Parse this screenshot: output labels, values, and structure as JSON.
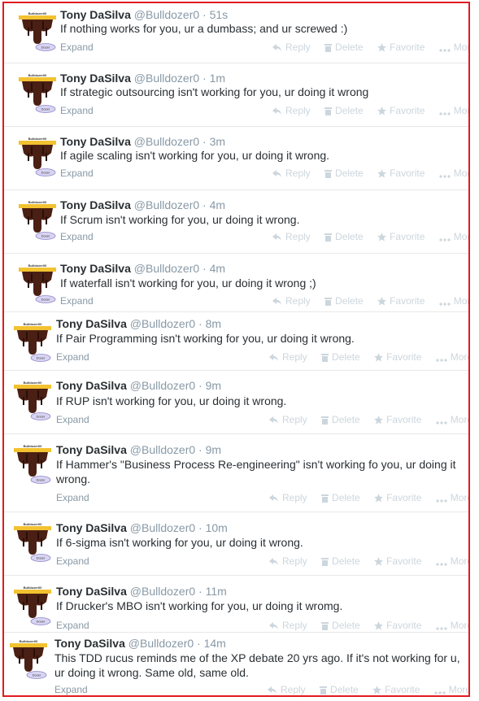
{
  "tweets": [
    {
      "name": "Tony DaSilva",
      "handle": "@Bulldozer0",
      "time": "51s",
      "text": "If nothing works for you, ur a dumbass; and ur screwed :)"
    },
    {
      "name": "Tony DaSilva",
      "handle": "@Bulldozer0",
      "time": "1m",
      "text": "If strategic outsourcing isn't working for you, ur doing it wrong"
    },
    {
      "name": "Tony DaSilva",
      "handle": "@Bulldozer0",
      "time": "3m",
      "text": "If agile scaling isn't working for you, ur doing it wrong."
    },
    {
      "name": "Tony DaSilva",
      "handle": "@Bulldozer0",
      "time": "4m",
      "text": "If Scrum isn't working for you, ur doing it wrong."
    },
    {
      "name": "Tony DaSilva",
      "handle": "@Bulldozer0",
      "time": "4m",
      "text": "If waterfall isn't working for you, ur doing it wrong ;)"
    },
    {
      "name": "Tony DaSilva",
      "handle": "@Bulldozer0",
      "time": "8m",
      "text": "If Pair Programming isn't working for you, ur doing it wrong."
    },
    {
      "name": "Tony DaSilva",
      "handle": "@Bulldozer0",
      "time": "9m",
      "text": "If RUP isn't working for you, ur doing it wrong."
    },
    {
      "name": "Tony DaSilva",
      "handle": "@Bulldozer0",
      "time": "9m",
      "text": "If Hammer's \"Business Process Re-engineering\" isn't working fo you, ur doing it wrong."
    },
    {
      "name": "Tony DaSilva",
      "handle": "@Bulldozer0",
      "time": "10m",
      "text": "If 6-sigma isn't working for you, ur doing it wrong."
    },
    {
      "name": "Tony DaSilva",
      "handle": "@Bulldozer0",
      "time": "11m",
      "text": "If Drucker's MBO isn't working for you, ur doing it wromg."
    },
    {
      "name": "Tony DaSilva",
      "handle": "@Bulldozer0",
      "time": "14m",
      "text": "This TDD rucus reminds me of the XP debate 20 yrs ago. If it's not working for u, ur doing it wrong. Same old, same old."
    }
  ],
  "labels": {
    "separator": "·",
    "expand": "Expand",
    "reply": "Reply",
    "delete": "Delete",
    "favorite": "Favorite",
    "more": "More",
    "avatar_banner": "Bulldozer00",
    "avatar_badge": "Dozer"
  },
  "colors": {
    "frame": "#e01b22",
    "muted": "#8899a6",
    "action": "#ccd6dd",
    "name": "#292f33"
  }
}
